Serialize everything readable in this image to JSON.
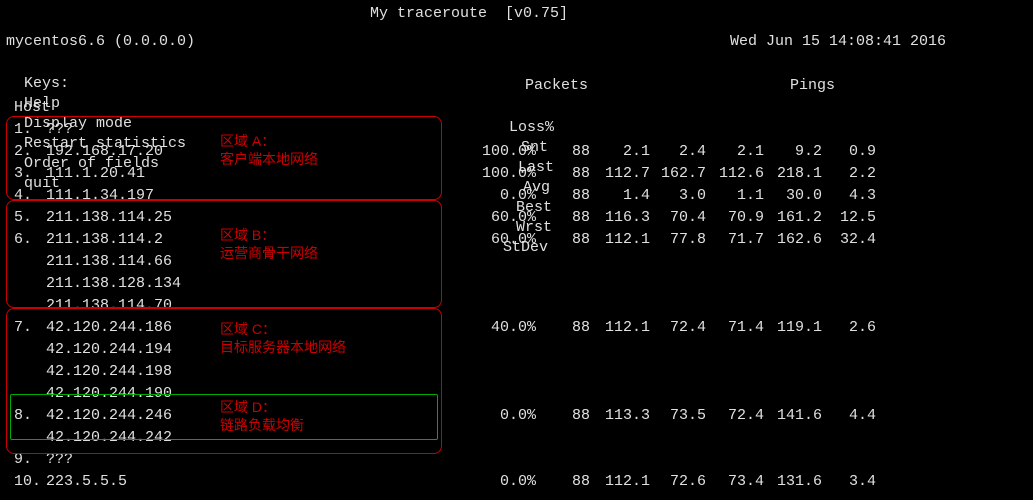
{
  "title": "My traceroute  [v0.75]",
  "hostline": "mycentos6.6 (0.0.0.0)",
  "datetime": "Wed Jun 15 14:08:41 2016",
  "menu": {
    "keys": "Keys:",
    "help": "Help",
    "display": "Display mode",
    "restart": "Restart statistics",
    "order": "Order of fields",
    "quit": "quit"
  },
  "sections": {
    "packets": "Packets",
    "pings": "Pings"
  },
  "headers": {
    "host": "Host",
    "loss": "Loss%",
    "snt": "Snt",
    "last": "Last",
    "avg": "Avg",
    "best": "Best",
    "wrst": "Wrst",
    "stdev": "StDev"
  },
  "rows": [
    {
      "n": "1.",
      "ip": "???"
    },
    {
      "n": "2.",
      "ip": "192.168.17.20",
      "loss": "100.0%",
      "snt": "88",
      "last": "2.1",
      "avg": "2.4",
      "best": "2.1",
      "wrst": "9.2",
      "stdev": "0.9"
    },
    {
      "n": "3.",
      "ip": "111.1.20.41",
      "loss": "100.0%",
      "snt": "88",
      "last": "112.7",
      "avg": "162.7",
      "best": "112.6",
      "wrst": "218.1",
      "stdev": "2.2"
    },
    {
      "n": "4.",
      "ip": "111.1.34.197",
      "loss": "0.0%",
      "snt": "88",
      "last": "1.4",
      "avg": "3.0",
      "best": "1.1",
      "wrst": "30.0",
      "stdev": "4.3"
    },
    {
      "n": "5.",
      "ip": "211.138.114.25",
      "loss": "60.0%",
      "snt": "88",
      "last": "116.3",
      "avg": "70.4",
      "best": "70.9",
      "wrst": "161.2",
      "stdev": "12.5"
    },
    {
      "n": "6.",
      "ip": "211.138.114.2",
      "loss": "60.0%",
      "snt": "88",
      "last": "112.1",
      "avg": "77.8",
      "best": "71.7",
      "wrst": "162.6",
      "stdev": "32.4"
    },
    {
      "n": "",
      "ip": "211.138.114.66"
    },
    {
      "n": "",
      "ip": "211.138.128.134"
    },
    {
      "n": "",
      "ip": "211.138.114.70"
    },
    {
      "n": "7.",
      "ip": "42.120.244.186",
      "loss": "40.0%",
      "snt": "88",
      "last": "112.1",
      "avg": "72.4",
      "best": "71.4",
      "wrst": "119.1",
      "stdev": "2.6"
    },
    {
      "n": "",
      "ip": "42.120.244.194"
    },
    {
      "n": "",
      "ip": "42.120.244.198"
    },
    {
      "n": "",
      "ip": "42.120.244.190"
    },
    {
      "n": "8.",
      "ip": "42.120.244.246",
      "loss": "0.0%",
      "snt": "88",
      "last": "113.3",
      "avg": "73.5",
      "best": "72.4",
      "wrst": "141.6",
      "stdev": "4.4"
    },
    {
      "n": "",
      "ip": "42.120.244.242"
    },
    {
      "n": "9.",
      "ip": "???"
    },
    {
      "n": "10.",
      "ip": "223.5.5.5",
      "loss": "0.0%",
      "snt": "88",
      "last": "112.1",
      "avg": "72.6",
      "best": "73.4",
      "wrst": "131.6",
      "stdev": "3.4"
    }
  ],
  "annotations": {
    "A": {
      "title": "区域 A：",
      "desc": "客户端本地网络"
    },
    "B": {
      "title": "区域 B：",
      "desc": "运营商骨干网络"
    },
    "C": {
      "title": "区域 C：",
      "desc": "目标服务器本地网络"
    },
    "D": {
      "title": "区域 D：",
      "desc": "链路负载均衡"
    }
  }
}
